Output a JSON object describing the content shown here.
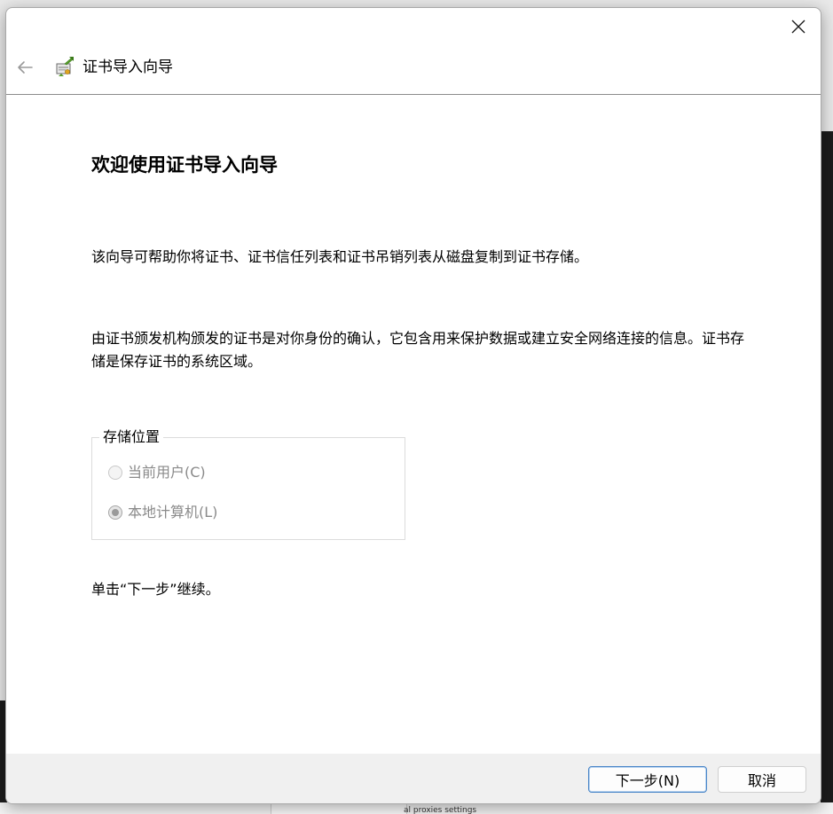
{
  "window": {
    "title": "证书导入向导"
  },
  "page": {
    "heading": "欢迎使用证书导入向导",
    "intro": "该向导可帮助你将证书、证书信任列表和证书吊销列表从磁盘复制到证书存储。",
    "description": "由证书颁发机构颁发的证书是对你身份的确认，它包含用来保护数据或建立安全网络连接的信息。证书存储是保存证书的系统区域。",
    "storage_group_label": "存储位置",
    "options": [
      {
        "label": "当前用户(C)",
        "selected": false,
        "enabled": false
      },
      {
        "label": "本地计算机(L)",
        "selected": true,
        "enabled": false
      }
    ],
    "continue_hint": "单击“下一步”继续。"
  },
  "buttons": {
    "next": "下一步(N)",
    "cancel": "取消"
  },
  "background": {
    "partial_text": "al proxies settings"
  },
  "icons": {
    "close": "close-icon",
    "back": "back-arrow-icon",
    "wizard": "certificate-wizard-icon",
    "accent_color": "#4a86c8"
  }
}
